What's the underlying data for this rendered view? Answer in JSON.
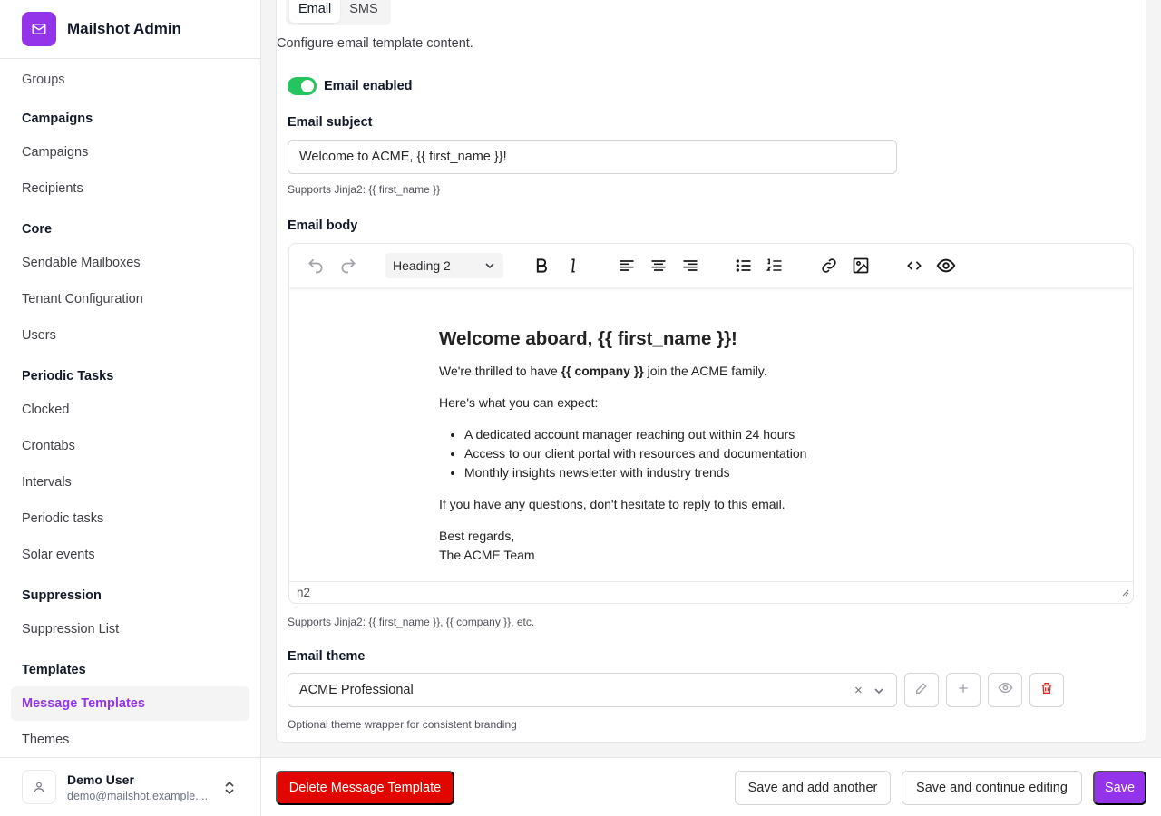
{
  "app": {
    "title": "Mailshot Admin"
  },
  "sidebar": {
    "partial_item": "Groups",
    "sections": [
      {
        "heading": "Campaigns",
        "items": [
          "Campaigns",
          "Recipients"
        ]
      },
      {
        "heading": "Core",
        "items": [
          "Sendable Mailboxes",
          "Tenant Configuration",
          "Users"
        ]
      },
      {
        "heading": "Periodic Tasks",
        "items": [
          "Clocked",
          "Crontabs",
          "Intervals",
          "Periodic tasks",
          "Solar events"
        ]
      },
      {
        "heading": "Suppression",
        "items": [
          "Suppression List"
        ]
      },
      {
        "heading": "Templates",
        "items": [
          "Message Templates",
          "Themes"
        ]
      }
    ],
    "active_item": "Message Templates",
    "user": {
      "name": "Demo User",
      "email": "demo@mailshot.example...."
    }
  },
  "tabs": [
    {
      "label": "Email",
      "active": true
    },
    {
      "label": "SMS",
      "active": false
    }
  ],
  "form": {
    "description": "Configure email template content.",
    "email_enabled": {
      "label": "Email enabled",
      "value": true
    },
    "subject": {
      "label": "Email subject",
      "value": "Welcome to ACME, {{ first_name }}!",
      "help": "Supports Jinja2: {{ first_name }}"
    },
    "body": {
      "label": "Email body",
      "block_format": "Heading 2",
      "status_path": "h2",
      "help": "Supports Jinja2: {{ first_name }}, {{ company }}, etc.",
      "content": {
        "heading": "Welcome aboard, {{ first_name }}!",
        "intro_before": "We're thrilled to have ",
        "intro_bold": "{{ company }}",
        "intro_after": " join the ACME family.",
        "expect": "Here's what you can expect:",
        "bullets": [
          "A dedicated account manager reaching out within 24 hours",
          "Access to our client portal with resources and documentation",
          "Monthly insights newsletter with industry trends"
        ],
        "questions": "If you have any questions, don't hesitate to reply to this email.",
        "signoff": "Best regards,",
        "signature": "The ACME Team"
      }
    },
    "theme": {
      "label": "Email theme",
      "value": "ACME Professional",
      "help": "Optional theme wrapper for consistent branding"
    }
  },
  "footer": {
    "delete_label": "Delete Message Template",
    "save_add_label": "Save and add another",
    "save_continue_label": "Save and continue editing",
    "save_label": "Save"
  },
  "colors": {
    "accent": "#9333ea",
    "danger": "#e10600",
    "toggle_on": "#22c55e"
  }
}
